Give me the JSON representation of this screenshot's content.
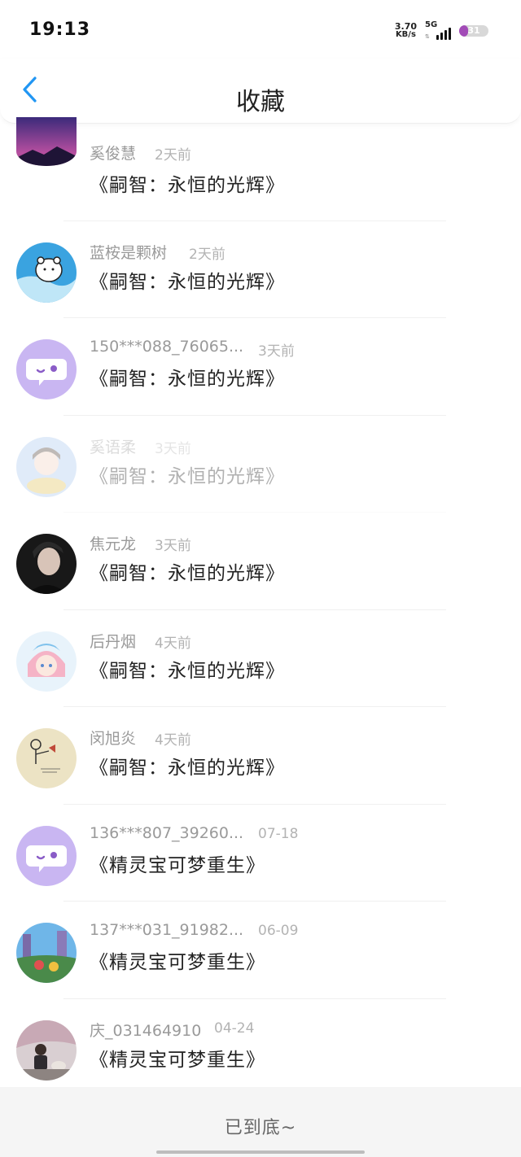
{
  "status_bar": {
    "time": "19:13",
    "net_speed_value": "3.70",
    "net_speed_unit": "KB/s",
    "network": "5G",
    "battery_level": "31"
  },
  "header": {
    "title": "收藏",
    "back_icon": "chevron-left-icon"
  },
  "colors": {
    "accent": "#2196f3",
    "battery": "#a24bb7",
    "avatar_default": "#c9b6f2"
  },
  "favorites": [
    {
      "name": "奚俊慧",
      "time": "2天前",
      "title": "《嗣智：永恒的光辉》",
      "avatar": "sunset-landscape-avatar"
    },
    {
      "name": "蓝桉是颗树",
      "time": "2天前",
      "title": "《嗣智：永恒的光辉》",
      "avatar": "cartoon-bear-avatar"
    },
    {
      "name": "150***088_76065...",
      "time": "3天前",
      "title": "《嗣智：永恒的光辉》",
      "avatar": "default-chat-avatar"
    },
    {
      "name": "奚语柔",
      "time": "3天前",
      "title": "《嗣智：永恒的光辉》",
      "avatar": "anime-girl-avatar"
    },
    {
      "name": "焦元龙",
      "time": "3天前",
      "title": "《嗣智：永恒的光辉》",
      "avatar": "portrait-avatar"
    },
    {
      "name": "后丹烟",
      "time": "4天前",
      "title": "《嗣智：永恒的光辉》",
      "avatar": "anime-pink-hair-avatar"
    },
    {
      "name": "闵旭炎",
      "time": "4天前",
      "title": "《嗣智：永恒的光辉》",
      "avatar": "sketch-drawing-avatar"
    },
    {
      "name": "136***807_39260...",
      "time": "07-18",
      "title": "《精灵宝可梦重生》",
      "avatar": "default-chat-avatar"
    },
    {
      "name": "137***031_91982...",
      "time": "06-09",
      "title": "《精灵宝可梦重生》",
      "avatar": "game-scene-avatar"
    },
    {
      "name": "庆_031464910",
      "time": "04-24",
      "title": "《精灵宝可梦重生》",
      "avatar": "photo-person-avatar"
    }
  ],
  "footer": {
    "end_text": "已到底~"
  }
}
